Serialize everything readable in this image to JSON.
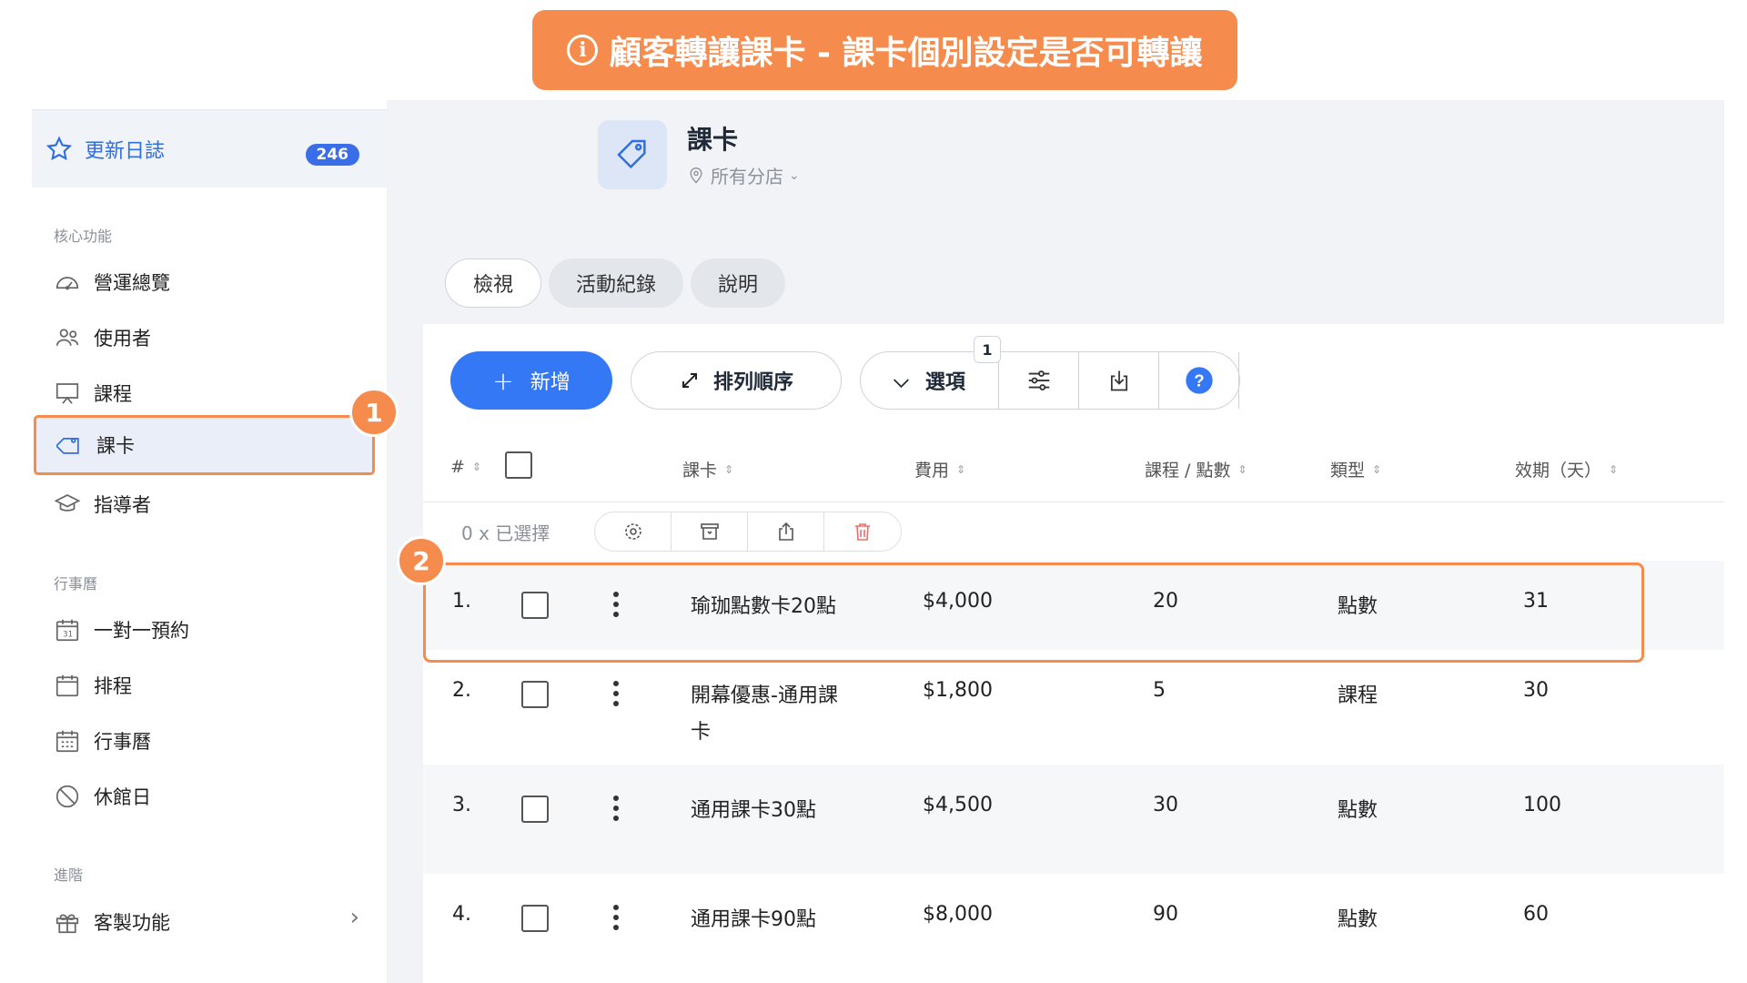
{
  "banner": {
    "icon": "info-icon",
    "text": "顧客轉讓課卡 - 課卡個別設定是否可轉讓"
  },
  "sidebar": {
    "changelog": {
      "label": "更新日誌",
      "badge": "246"
    },
    "sections": {
      "core": "核心功能",
      "calendar": "行事曆",
      "advanced": "進階"
    },
    "items": [
      {
        "label": "營運總覽",
        "icon": "dashboard-icon"
      },
      {
        "label": "使用者",
        "icon": "users-icon"
      },
      {
        "label": "課程",
        "icon": "presentation-icon"
      },
      {
        "label": "課卡",
        "icon": "tag-icon"
      },
      {
        "label": "指導者",
        "icon": "graduation-cap-icon"
      },
      {
        "label": "一對一預約",
        "icon": "calendar-31-icon"
      },
      {
        "label": "排程",
        "icon": "calendar-icon"
      },
      {
        "label": "行事曆",
        "icon": "calendar-grid-icon"
      },
      {
        "label": "休館日",
        "icon": "ban-icon"
      },
      {
        "label": "客製功能",
        "icon": "gift-icon"
      }
    ]
  },
  "header": {
    "title": "課卡",
    "location": "所有分店"
  },
  "tabs": [
    "檢視",
    "活動紀錄",
    "說明"
  ],
  "toolbar": {
    "add": "新增",
    "sort": "排列順序",
    "options": "選項",
    "options_count": "1"
  },
  "table": {
    "headers": [
      "#",
      "課卡",
      "費用",
      "課程 / 點數",
      "類型",
      "效期（天）"
    ],
    "selected": "0 x 已選擇",
    "rows": [
      {
        "num": "1.",
        "name": "瑜珈點數卡20點",
        "name2": "",
        "price": "$4,000",
        "qty": "20",
        "type": "點數",
        "days": "31"
      },
      {
        "num": "2.",
        "name": "開幕優惠-通用課",
        "name2": "卡",
        "price": "$1,800",
        "qty": "5",
        "type": "課程",
        "days": "30"
      },
      {
        "num": "3.",
        "name": "通用課卡30點",
        "name2": "",
        "price": "$4,500",
        "qty": "30",
        "type": "點數",
        "days": "100"
      },
      {
        "num": "4.",
        "name": "通用課卡90點",
        "name2": "",
        "price": "$8,000",
        "qty": "90",
        "type": "點數",
        "days": "60"
      }
    ]
  },
  "steps": [
    "1",
    "2"
  ],
  "colors": {
    "accent": "#f58b4c",
    "primary": "#3478f6",
    "badge": "#3a6ee8"
  }
}
